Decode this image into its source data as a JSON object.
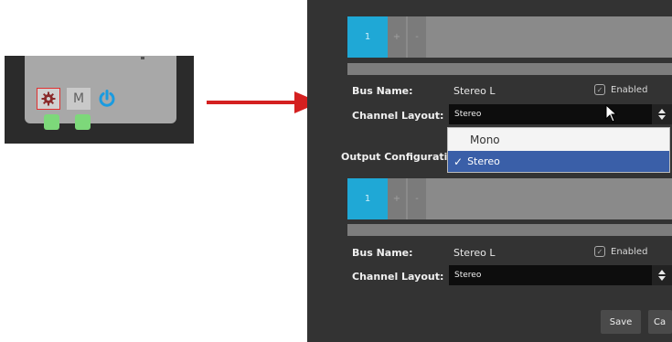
{
  "node": {
    "gear_icon": "gear-icon",
    "mute_label": "M",
    "power_icon": "power-icon"
  },
  "arrow_color": "#d42020",
  "bus1": {
    "tab_label": "1",
    "add_label": "+",
    "remove_label": "-",
    "bus_name_label": "Bus Name:",
    "bus_name_value": "Stereo L",
    "enabled_label": "Enabled",
    "channel_layout_label": "Channel Layout:",
    "channel_layout_value": "Stereo"
  },
  "dropdown": {
    "options": [
      "Mono",
      "Stereo"
    ],
    "selected_check": "✓",
    "selected": "Stereo"
  },
  "output_config_label": "Output Configuration",
  "bus2": {
    "tab_label": "1",
    "add_label": "+",
    "remove_label": "-",
    "bus_name_label": "Bus Name:",
    "bus_name_value": "Stereo L",
    "enabled_label": "Enabled",
    "channel_layout_label": "Channel Layout:",
    "channel_layout_value": "Stereo"
  },
  "buttons": {
    "save": "Save",
    "cancel": "Ca"
  },
  "colors": {
    "accent_blue": "#1fa8d6",
    "selection_blue": "#3a5fa8",
    "pin_green": "#7dd87a",
    "gear_highlight": "#e03030"
  }
}
